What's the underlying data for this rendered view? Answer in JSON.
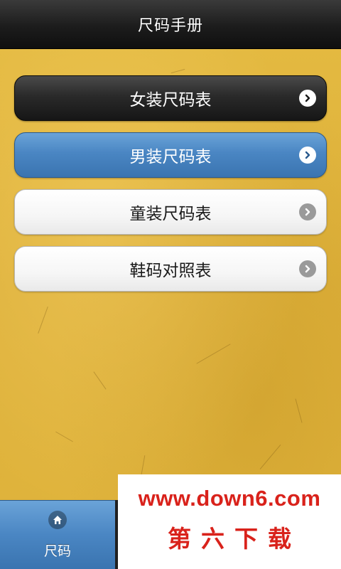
{
  "header": {
    "title": "尺码手册"
  },
  "menu": {
    "items": [
      {
        "label": "女装尺码表",
        "style": "dark",
        "arrow_icon": "chevron-right-circle-icon"
      },
      {
        "label": "男装尺码表",
        "style": "blue",
        "arrow_icon": "chevron-right-circle-icon"
      },
      {
        "label": "童装尺码表",
        "style": "light",
        "arrow_icon": "chevron-right-circle-icon"
      },
      {
        "label": "鞋码对照表",
        "style": "light",
        "arrow_icon": "chevron-right-circle-icon"
      }
    ]
  },
  "tabbar": {
    "active_tab": {
      "label": "尺码",
      "icon": "home-icon"
    }
  },
  "watermark": {
    "url": "www.down6.com",
    "name": "第六下载"
  },
  "colors": {
    "background": "#e2b63a",
    "header": "#1c1c1c",
    "accent_blue": "#4a86c3",
    "watermark_red": "#d9221b"
  }
}
